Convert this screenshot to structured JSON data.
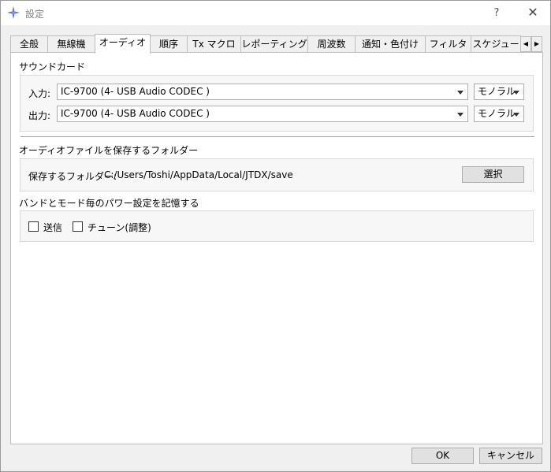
{
  "window": {
    "title": "設定",
    "help_label": "?",
    "close_label": "✕"
  },
  "tabs": [
    {
      "label": "全般",
      "active": false
    },
    {
      "label": "無線機",
      "active": false
    },
    {
      "label": "オーディオ",
      "active": true
    },
    {
      "label": "順序",
      "active": false
    },
    {
      "label": "Tx マクロ",
      "active": false
    },
    {
      "label": "レポーティング",
      "active": false
    },
    {
      "label": "周波数",
      "active": false
    },
    {
      "label": "通知・色付け",
      "active": false
    },
    {
      "label": "フィルタ",
      "active": false
    },
    {
      "label": "スケジュー",
      "active": false
    }
  ],
  "soundcard": {
    "title": "サウンドカード",
    "input_label": "入力:",
    "input_value": "IC-9700 (4- USB Audio CODEC )",
    "input_channel": "モノラル",
    "output_label": "出力:",
    "output_value": "IC-9700 (4- USB Audio CODEC )",
    "output_channel": "モノラル"
  },
  "save_folder": {
    "title": "オーディオファイルを保存するフォルダー",
    "label": "保存するフォルダー:",
    "path": "C:/Users/Toshi/AppData/Local/JTDX/save",
    "select_button": "選択"
  },
  "power_memory": {
    "title": "バンドとモード毎のパワー設定を記憶する",
    "transmit_label": "送信",
    "transmit_checked": false,
    "tune_label": "チューン(調整)",
    "tune_checked": false
  },
  "footer": {
    "ok_label": "OK",
    "cancel_label": "キャンセル"
  }
}
